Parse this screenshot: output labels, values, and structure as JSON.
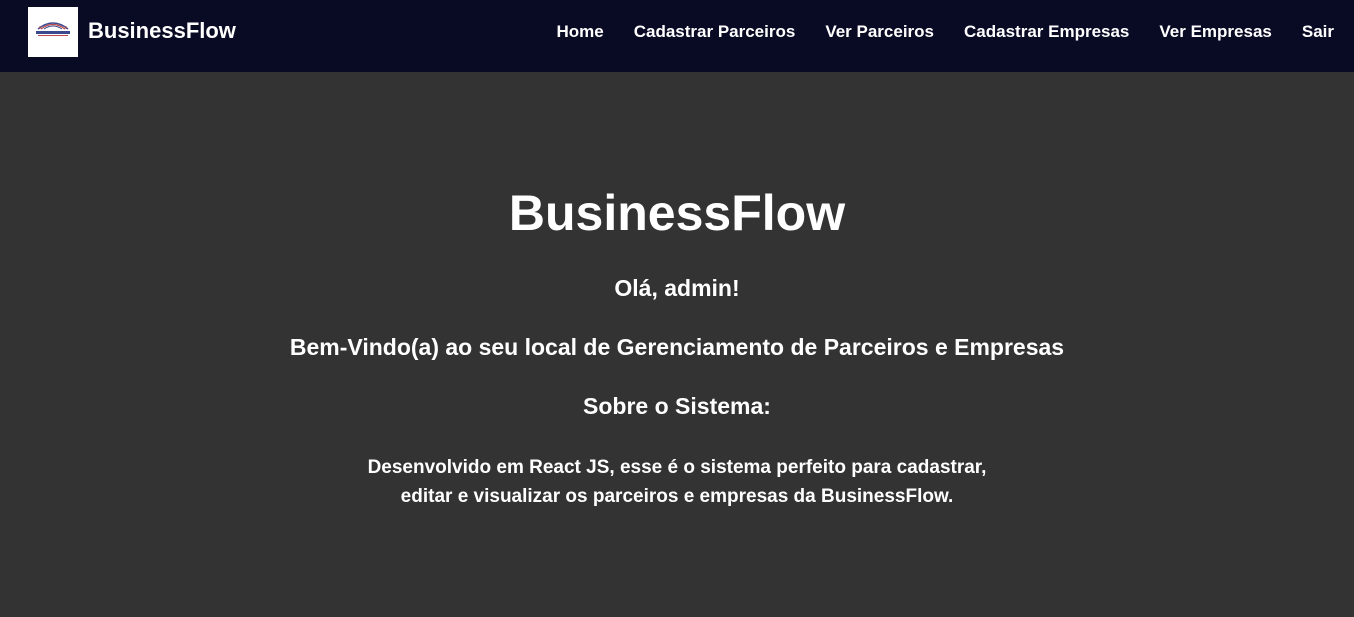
{
  "navbar": {
    "logo_icon": "businessflow-logo-icon",
    "brand": "BusinessFlow",
    "links": [
      {
        "label": "Home"
      },
      {
        "label": "Cadastrar Parceiros"
      },
      {
        "label": "Ver Parceiros"
      },
      {
        "label": "Cadastrar Empresas"
      },
      {
        "label": "Ver Empresas"
      },
      {
        "label": "Sair"
      }
    ]
  },
  "main": {
    "title": "BusinessFlow",
    "greeting": "Olá, admin!",
    "welcome": "Bem-Vindo(a) ao seu local de Gerenciamento de Parceiros e Empresas",
    "about_title": "Sobre o Sistema:",
    "about_line1": "Desenvolvido em React JS, esse é o sistema perfeito para cadastrar,",
    "about_line2": "editar e visualizar os parceiros e empresas da BusinessFlow."
  },
  "colors": {
    "navbar_bg": "#090a24",
    "page_bg": "#333333",
    "text": "#ffffff"
  }
}
